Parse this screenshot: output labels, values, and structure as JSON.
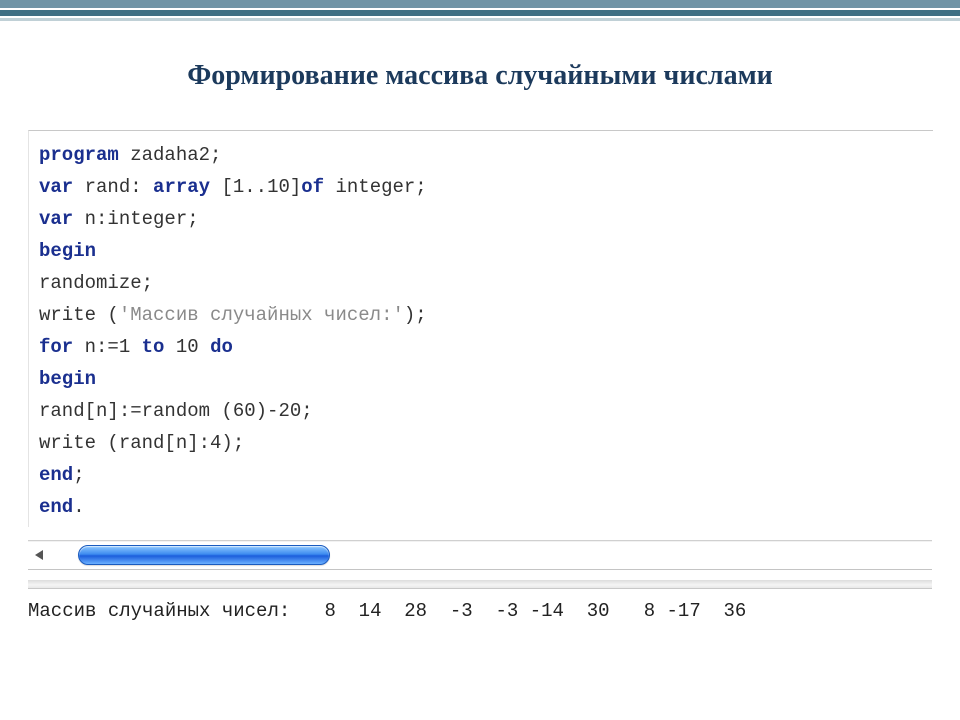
{
  "title": "Формирование массива случайными числами",
  "code": {
    "l1_kw": "program",
    "l1_rest": " zadaha2;",
    "l2_kw1": "var",
    "l2_mid": " rand: ",
    "l2_kw2": "array",
    "l2_mid2": " [1..10]",
    "l2_kw3": "of",
    "l2_rest": " integer;",
    "l3_kw": "var",
    "l3_rest": " n:integer;",
    "l4_kw": "begin",
    "l5": "randomize;",
    "l6_a": "write (",
    "l6_str": "'Массив случайных чисел:'",
    "l6_b": ");",
    "l7_kw1": "for",
    "l7_mid1": " n:=1 ",
    "l7_kw2": "to",
    "l7_mid2": " 10 ",
    "l7_kw3": "do",
    "l8_kw": "begin",
    "l9": "rand[n]:=random (60)-20;",
    "l10": "write (rand[n]:4);",
    "l11_kw": "end",
    "l11_rest": ";",
    "l12_kw": "end",
    "l12_rest": "."
  },
  "output": {
    "label": "Массив случайных чисел:",
    "values": "   8  14  28  -3  -3 -14  30   8 -17  36"
  }
}
